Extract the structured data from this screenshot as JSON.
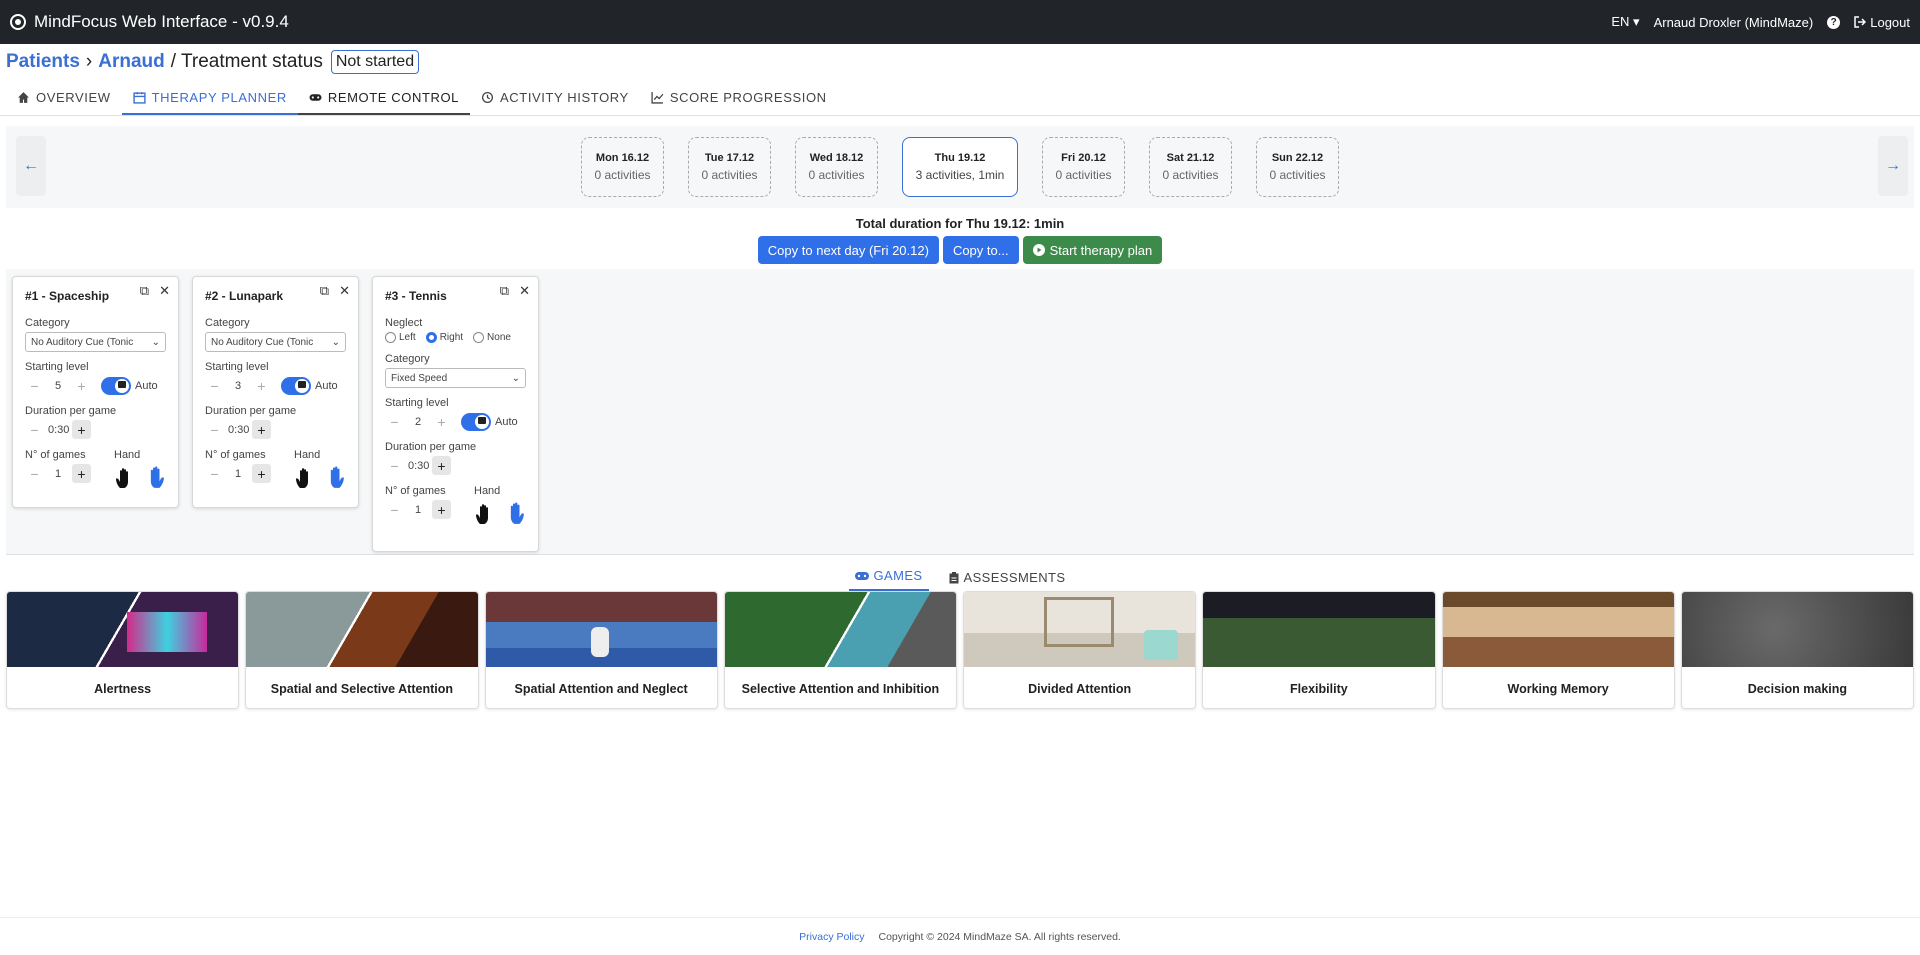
{
  "app": {
    "title": "MindFocus Web Interface - v0.9.4",
    "lang": "EN",
    "user": "Arnaud Droxler (MindMaze)",
    "logout": "Logout"
  },
  "breadcrumb": {
    "patients": "Patients",
    "patient": "Arnaud",
    "status_label": "/ Treatment status",
    "status": "Not started"
  },
  "tabs": [
    {
      "label": "OVERVIEW"
    },
    {
      "label": "THERAPY PLANNER"
    },
    {
      "label": "REMOTE CONTROL"
    },
    {
      "label": "ACTIVITY HISTORY"
    },
    {
      "label": "SCORE PROGRESSION"
    }
  ],
  "days": [
    {
      "day": "Mon 16.12",
      "activities": "0 activities"
    },
    {
      "day": "Tue 17.12",
      "activities": "0 activities"
    },
    {
      "day": "Wed 18.12",
      "activities": "0 activities"
    },
    {
      "day": "Thu 19.12",
      "activities": "3 activities, 1min"
    },
    {
      "day": "Fri 20.12",
      "activities": "0 activities"
    },
    {
      "day": "Sat 21.12",
      "activities": "0 activities"
    },
    {
      "day": "Sun 22.12",
      "activities": "0 activities"
    }
  ],
  "summary": "Total duration for Thu 19.12: 1min",
  "actions": {
    "copy_next": "Copy to next day (Fri 20.12)",
    "copy_to": "Copy to...",
    "start": "Start therapy plan"
  },
  "activities": [
    {
      "title": "#1 - Spaceship",
      "category_label": "Category",
      "category": "No Auditory Cue (Tonic",
      "level_label": "Starting level",
      "level": "5",
      "auto": "Auto",
      "duration_label": "Duration per game",
      "duration": "0:30",
      "games_label": "N° of games",
      "games": "1",
      "hand_label": "Hand"
    },
    {
      "title": "#2 - Lunapark",
      "category_label": "Category",
      "category": "No Auditory Cue (Tonic",
      "level_label": "Starting level",
      "level": "3",
      "auto": "Auto",
      "duration_label": "Duration per game",
      "duration": "0:30",
      "games_label": "N° of games",
      "games": "1",
      "hand_label": "Hand"
    },
    {
      "title": "#3 - Tennis",
      "neglect_label": "Neglect",
      "neglect_opts": [
        "Left",
        "Right",
        "None"
      ],
      "category_label": "Category",
      "category": "Fixed Speed",
      "level_label": "Starting level",
      "level": "2",
      "auto": "Auto",
      "duration_label": "Duration per game",
      "duration": "0:30",
      "games_label": "N° of games",
      "games": "1",
      "hand_label": "Hand"
    }
  ],
  "game_tabs": {
    "games": "GAMES",
    "assessments": "ASSESSMENTS"
  },
  "games": [
    {
      "name": "Alertness"
    },
    {
      "name": "Spatial and Selective Attention"
    },
    {
      "name": "Spatial Attention and Neglect"
    },
    {
      "name": "Selective Attention and Inhibition"
    },
    {
      "name": "Divided Attention"
    },
    {
      "name": "Flexibility"
    },
    {
      "name": "Working Memory"
    },
    {
      "name": "Decision making"
    }
  ],
  "footer": {
    "privacy": "Privacy Policy",
    "copyright": "Copyright © 2024 MindMaze SA. All rights reserved."
  },
  "colors": {
    "accent": "#2f6fe8",
    "start": "#3d8b4a",
    "topbar": "#212529"
  }
}
